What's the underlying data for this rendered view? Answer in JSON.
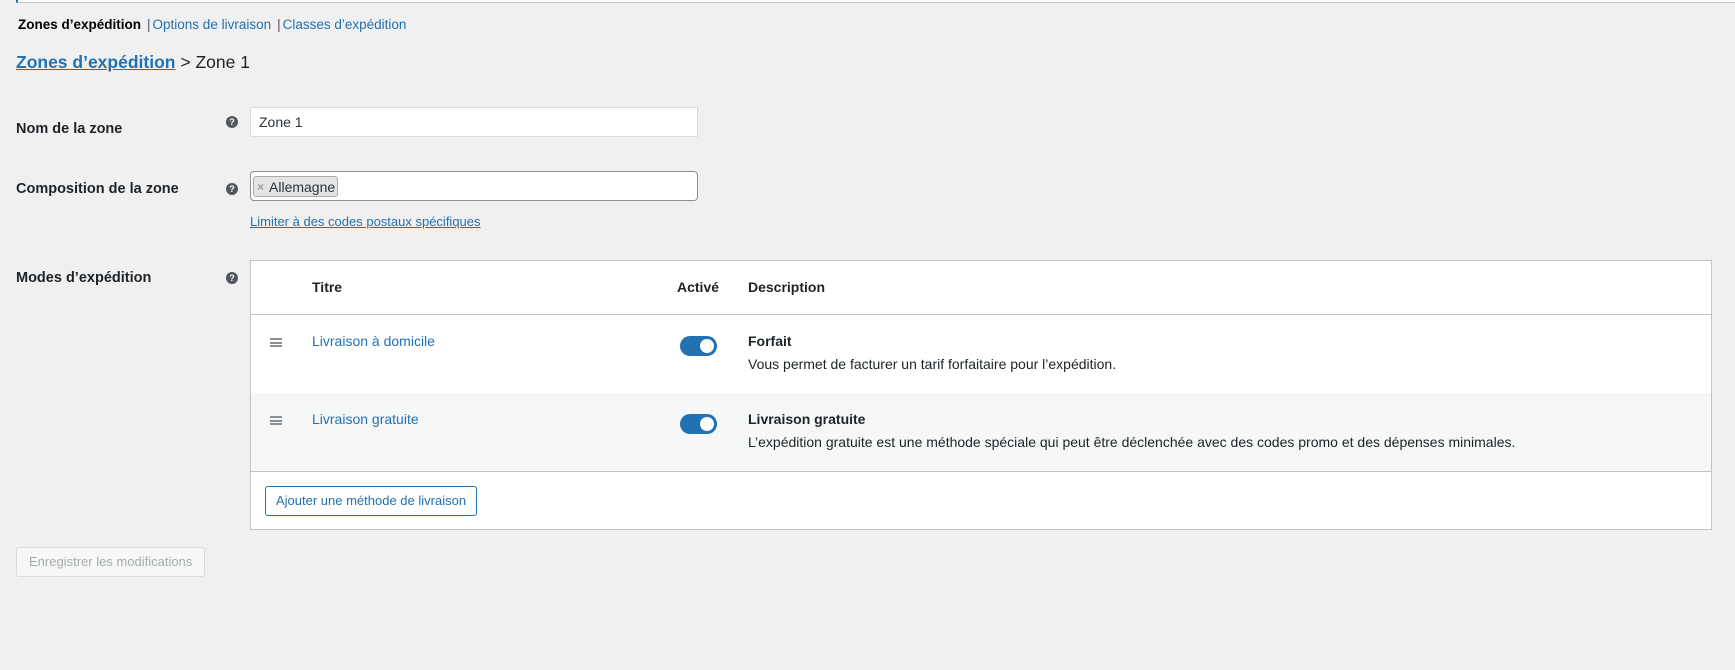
{
  "subnav": {
    "current": "Zones d’expédition",
    "items": [
      "Options de livraison",
      "Classes d’expédition"
    ],
    "separator": "|"
  },
  "breadcrumb": {
    "parent": "Zones d’expédition",
    "separator": ">",
    "current": "Zone 1"
  },
  "zone_name": {
    "label": "Nom de la zone",
    "value": "Zone 1"
  },
  "zone_regions": {
    "label": "Composition de la zone",
    "chips": [
      "Allemagne"
    ],
    "remove_glyph": "×",
    "postal_link": "Limiter à des codes postaux spécifiques"
  },
  "methods": {
    "label": "Modes d’expédition",
    "headers": {
      "title": "Titre",
      "enabled": "Activé",
      "description": "Description"
    },
    "rows": [
      {
        "title": "Livraison à domicile",
        "enabled": true,
        "desc_title": "Forfait",
        "desc_text": "Vous permet de facturer un tarif forfaitaire pour l’expédition."
      },
      {
        "title": "Livraison gratuite",
        "enabled": true,
        "desc_title": "Livraison gratuite",
        "desc_text": "L’expédition gratuite est une méthode spéciale qui peut être déclenchée avec des codes promo et des dépenses minimales."
      }
    ],
    "add_button": "Ajouter une méthode de livraison"
  },
  "help_glyph": "?",
  "save_button": "Enregistrer les modifications",
  "colors": {
    "accent": "#2271b1",
    "background": "#f0f0f1"
  }
}
